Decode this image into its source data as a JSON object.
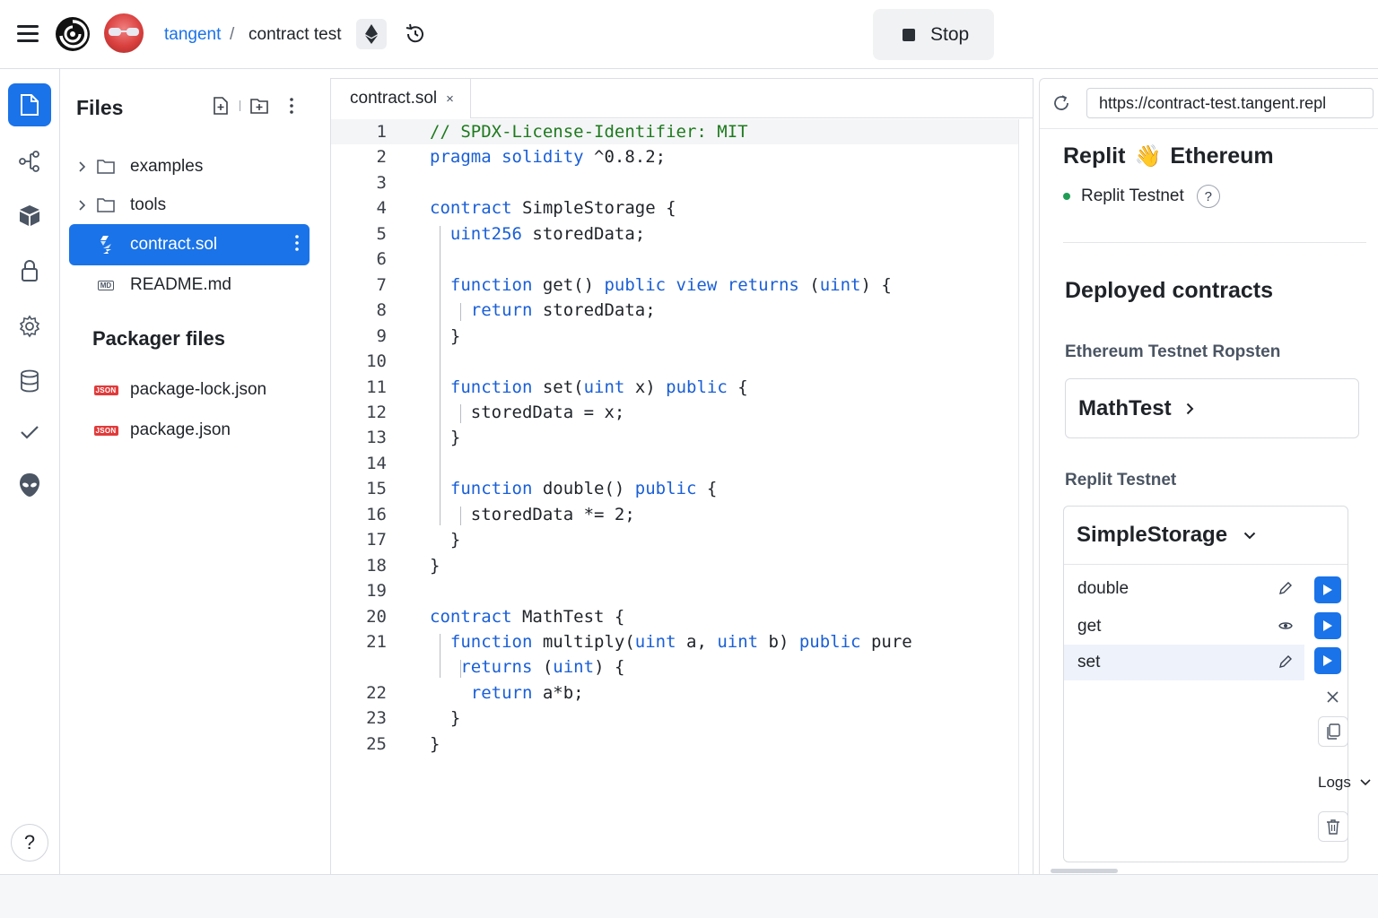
{
  "topbar": {
    "breadcrumb_user": "tangent",
    "breadcrumb_separator": "/",
    "breadcrumb_project": "contract test",
    "stop_label": "Stop",
    "icons": [
      "menu-icon",
      "replit-logo-icon",
      "avatar",
      "ethereum-icon",
      "history-icon",
      "stop-icon"
    ]
  },
  "rail": {
    "items": [
      "files-icon",
      "git-icon",
      "packages-icon",
      "secrets-icon",
      "settings-icon",
      "database-icon",
      "check-icon",
      "alien-icon"
    ],
    "active": "files-icon",
    "help_label": "?"
  },
  "files": {
    "title": "Files",
    "items": [
      {
        "label": "examples",
        "type": "folder"
      },
      {
        "label": "tools",
        "type": "folder"
      },
      {
        "label": "contract.sol",
        "type": "solidity",
        "selected": true
      },
      {
        "label": "README.md",
        "type": "markdown"
      }
    ],
    "packager_title": "Packager files",
    "packager_items": [
      {
        "label": "package-lock.json",
        "badge": "JSON"
      },
      {
        "label": "package.json",
        "badge": "JSON"
      }
    ],
    "md_badge": "MD"
  },
  "editor": {
    "tab_label": "contract.sol",
    "tab_close": "×",
    "lines": [
      {
        "n": "1",
        "tokens": [
          {
            "t": "// SPDX-License-Identifier: MIT",
            "c": "cm"
          }
        ]
      },
      {
        "n": "2",
        "tokens": [
          {
            "t": "pragma solidity",
            "c": "kw"
          },
          {
            "t": " ^0.8.2;"
          }
        ]
      },
      {
        "n": "3",
        "tokens": []
      },
      {
        "n": "4",
        "tokens": [
          {
            "t": "contract",
            "c": "kw"
          },
          {
            "t": " SimpleStorage {"
          }
        ]
      },
      {
        "n": "5",
        "tokens": [
          {
            "t": "  "
          },
          {
            "t": "uint256",
            "c": "kw"
          },
          {
            "t": " storedData;"
          }
        ]
      },
      {
        "n": "6",
        "tokens": []
      },
      {
        "n": "7",
        "tokens": [
          {
            "t": "  "
          },
          {
            "t": "function",
            "c": "kw"
          },
          {
            "t": " get() "
          },
          {
            "t": "public view returns",
            "c": "kw"
          },
          {
            "t": " ("
          },
          {
            "t": "uint",
            "c": "kw"
          },
          {
            "t": ") {"
          }
        ]
      },
      {
        "n": "8",
        "tokens": [
          {
            "t": "    "
          },
          {
            "t": "return",
            "c": "kw"
          },
          {
            "t": " storedData;"
          }
        ]
      },
      {
        "n": "9",
        "tokens": [
          {
            "t": "  }"
          }
        ]
      },
      {
        "n": "10",
        "tokens": []
      },
      {
        "n": "11",
        "tokens": [
          {
            "t": "  "
          },
          {
            "t": "function",
            "c": "kw"
          },
          {
            "t": " set("
          },
          {
            "t": "uint",
            "c": "kw"
          },
          {
            "t": " x) "
          },
          {
            "t": "public",
            "c": "kw"
          },
          {
            "t": " {"
          }
        ]
      },
      {
        "n": "12",
        "tokens": [
          {
            "t": "    storedData = x;"
          }
        ]
      },
      {
        "n": "13",
        "tokens": [
          {
            "t": "  }"
          }
        ]
      },
      {
        "n": "14",
        "tokens": []
      },
      {
        "n": "15",
        "tokens": [
          {
            "t": "  "
          },
          {
            "t": "function",
            "c": "kw"
          },
          {
            "t": " double() "
          },
          {
            "t": "public",
            "c": "kw"
          },
          {
            "t": " {"
          }
        ]
      },
      {
        "n": "16",
        "tokens": [
          {
            "t": "    storedData *= 2;"
          }
        ]
      },
      {
        "n": "17",
        "tokens": [
          {
            "t": "  }"
          }
        ]
      },
      {
        "n": "18",
        "tokens": [
          {
            "t": "}"
          }
        ]
      },
      {
        "n": "19",
        "tokens": []
      },
      {
        "n": "20",
        "tokens": [
          {
            "t": "contract",
            "c": "kw"
          },
          {
            "t": " MathTest {"
          }
        ]
      },
      {
        "n": "21",
        "tokens": [
          {
            "t": "  "
          },
          {
            "t": "function",
            "c": "kw"
          },
          {
            "t": " multiply("
          },
          {
            "t": "uint",
            "c": "kw"
          },
          {
            "t": " a, "
          },
          {
            "t": "uint",
            "c": "kw"
          },
          {
            "t": " b) "
          },
          {
            "t": "public",
            "c": "kw"
          },
          {
            "t": " pure"
          }
        ]
      },
      {
        "n": "",
        "tokens": [
          {
            "t": "   "
          },
          {
            "t": "returns",
            "c": "kw"
          },
          {
            "t": " ("
          },
          {
            "t": "uint",
            "c": "kw"
          },
          {
            "t": ") {"
          }
        ]
      },
      {
        "n": "22",
        "tokens": [
          {
            "t": "    "
          },
          {
            "t": "return",
            "c": "kw"
          },
          {
            "t": " a*b;"
          }
        ]
      },
      {
        "n": "23",
        "tokens": [
          {
            "t": "  }"
          }
        ]
      },
      {
        "n": "25",
        "tokens": [
          {
            "t": "}"
          }
        ]
      }
    ]
  },
  "right": {
    "url": "https://contract-test.tangent.repl",
    "title_left": "Replit",
    "title_emoji": "👋",
    "title_right": "Ethereum",
    "network": "Replit Testnet",
    "network_help": "?",
    "deployed_title": "Deployed contracts",
    "ropsten_label": "Ethereum Testnet Ropsten",
    "math_contract": "MathTest",
    "replit_label": "Replit Testnet",
    "ss_contract": "SimpleStorage",
    "functions": [
      {
        "name": "double",
        "action_icon": "pencil-icon"
      },
      {
        "name": "get",
        "action_icon": "eye-icon"
      },
      {
        "name": "set",
        "action_icon": "pencil-icon"
      }
    ],
    "logs_label": "Logs"
  }
}
